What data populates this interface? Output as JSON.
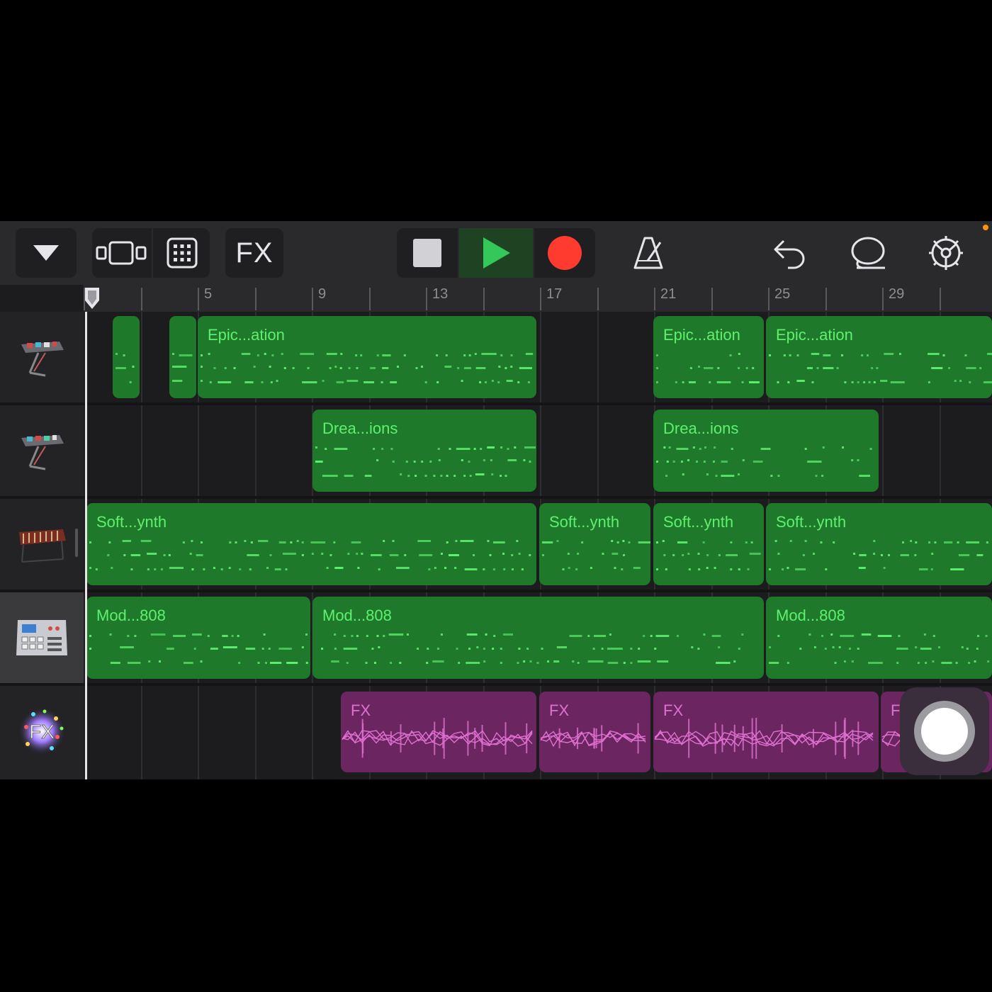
{
  "toolbar": {
    "fx_label": "FX",
    "play_color": "#34c759",
    "record_color": "#ff3b30",
    "icons": [
      "tracks-dropdown-icon",
      "view-toggle-icon",
      "grid-icon",
      "stop-icon",
      "play-icon",
      "record-icon",
      "metronome-icon",
      "undo-icon",
      "loop-icon",
      "settings-icon"
    ]
  },
  "ruler": {
    "bar_labels": [
      "5",
      "9",
      "13",
      "17",
      "21",
      "25",
      "29"
    ],
    "add_label": "+"
  },
  "tracks": [
    {
      "name": "keyboard-synth-1",
      "icon": "synth-stand-icon"
    },
    {
      "name": "keyboard-synth-2",
      "icon": "synth-stand-icon"
    },
    {
      "name": "marimba",
      "icon": "marimba-icon"
    },
    {
      "name": "drum-machine",
      "icon": "drum-machine-icon",
      "selected": true
    },
    {
      "name": "fx",
      "icon": "fx-sparkle-icon"
    }
  ],
  "regions": {
    "track1": [
      "Epic...ation",
      "Epic...ation",
      "Epic...ation"
    ],
    "track2": [
      "Drea...ions",
      "Drea...ions"
    ],
    "track3": [
      "Soft...ynth",
      "Soft...ynth",
      "Soft...ynth",
      "Soft...ynth"
    ],
    "track4": [
      "Mod...808",
      "Mod...808",
      "Mod...808"
    ],
    "track5": [
      "FX",
      "FX",
      "FX",
      "F"
    ]
  },
  "colors": {
    "region_green": "#1e7a2a",
    "note_green": "#5ff06f",
    "region_purple": "#6b2662",
    "wave_pink": "#e070d0"
  }
}
